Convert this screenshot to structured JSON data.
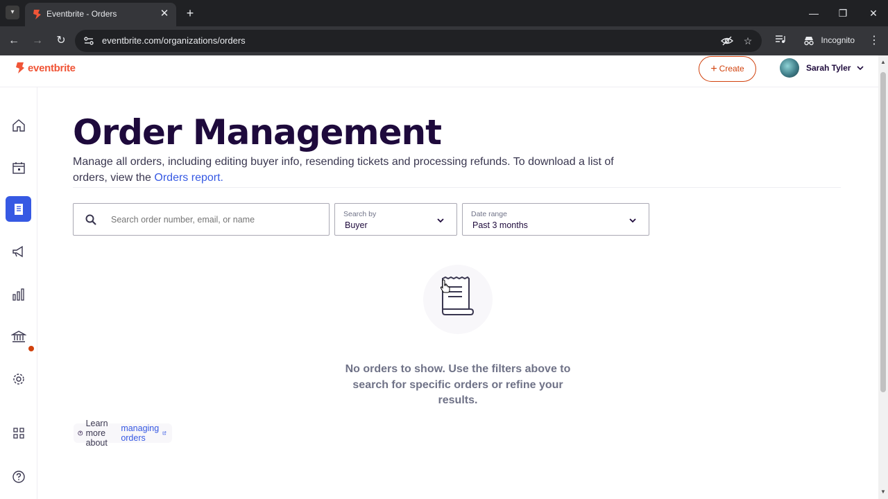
{
  "browser": {
    "tab_title": "Eventbrite - Orders",
    "url": "eventbrite.com/organizations/orders",
    "incognito_label": "Incognito"
  },
  "header": {
    "logo_text": "eventbrite",
    "create_label": "Create",
    "user_name": "Sarah Tyler"
  },
  "sidebar": {
    "items": [
      {
        "name": "home",
        "icon": "home-icon"
      },
      {
        "name": "events",
        "icon": "calendar-icon"
      },
      {
        "name": "orders",
        "icon": "orders-icon",
        "active": true
      },
      {
        "name": "marketing",
        "icon": "megaphone-icon"
      },
      {
        "name": "reports",
        "icon": "bar-chart-icon"
      },
      {
        "name": "finance",
        "icon": "bank-icon",
        "notification": true
      },
      {
        "name": "settings",
        "icon": "gear-icon"
      },
      {
        "name": "apps",
        "icon": "grid-icon"
      },
      {
        "name": "help",
        "icon": "help-icon"
      }
    ]
  },
  "main": {
    "title": "Order Management",
    "description_prefix": "Manage all orders, including editing buyer info, resending tickets and processing refunds. To download a list of orders, view the ",
    "description_link": "Orders report",
    "description_suffix": ".",
    "search": {
      "placeholder": "Search order number, email, or name"
    },
    "search_by": {
      "label": "Search by",
      "value": "Buyer"
    },
    "date_range": {
      "label": "Date range",
      "value": "Past 3 months"
    },
    "empty_state": "No orders to show. Use the filters above to search for specific orders or refine your results.",
    "learn_more": {
      "prefix": "Learn more about",
      "link": "managing orders"
    }
  },
  "colors": {
    "brand": "#f05537",
    "accent": "#3659e3",
    "heading": "#1e0a3c"
  }
}
